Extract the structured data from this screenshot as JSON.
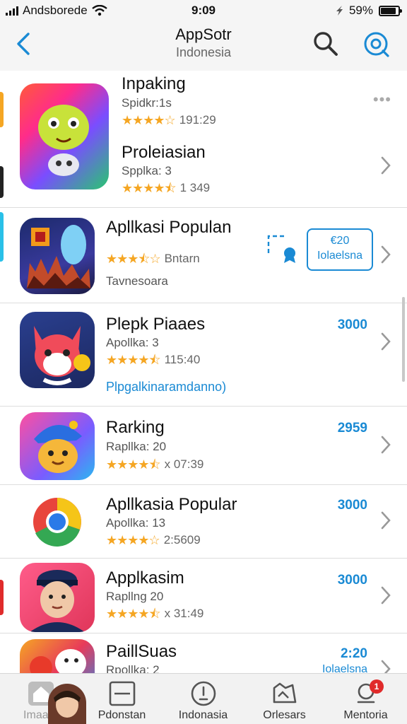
{
  "status_bar": {
    "carrier": "Andsborede",
    "time": "9:09",
    "battery": "59%"
  },
  "nav": {
    "title": "AppSotr",
    "subtitle": "Indonesia",
    "back_icon": "chevron-left-icon",
    "search_icon": "search-icon",
    "discover_icon": "compass-icon"
  },
  "featured": {
    "first": {
      "name": "Inpaking",
      "sub": "Spidkr:1s",
      "stars": 4,
      "rating_text": "191:29",
      "more": "•••"
    },
    "second": {
      "name": "Proleiasian",
      "sub": "Spplka: 3",
      "stars": 4.5,
      "rating_text": "1 349"
    }
  },
  "popular": {
    "name": "Apllkasi Populan",
    "rating_label": "Bntarn",
    "stars": 3.5,
    "category": "Tavnesoara",
    "badge_line1": "€20",
    "badge_line2": "Iolaelsna"
  },
  "list": [
    {
      "name": "Plepk Piaaes",
      "sub": "Apollka: 3",
      "stars": 4.5,
      "rating_text": "115:40",
      "price": "3000",
      "link": "Plpgalkinaramdanno)"
    },
    {
      "name": "Rarking",
      "sub": "Rapllka: 20",
      "stars": 4.5,
      "rating_text": "x 07:39",
      "price": "2959"
    },
    {
      "name": "Apllkasia Popular",
      "sub": "Apollka: 13",
      "stars": 4,
      "rating_text": "2:5609",
      "price": "3000"
    },
    {
      "name": "Applkasim",
      "sub": "Rapllng 20",
      "stars": 4.5,
      "rating_text": "x 31:49",
      "price": "3000"
    },
    {
      "name": "PaillSuas",
      "sub": "Rpollka: 2",
      "price": "2:20",
      "price_sub": "Iolaelsna"
    }
  ],
  "tabs": [
    {
      "label": "Imaam",
      "icon": "home-icon"
    },
    {
      "label": "Pdonstan",
      "icon": "apps-icon"
    },
    {
      "label": "Indonasia",
      "icon": "arrow-down-circle-icon"
    },
    {
      "label": "Orlesars",
      "icon": "games-icon"
    },
    {
      "label": "Mentoria",
      "icon": "profile-icon",
      "badge": "1"
    }
  ],
  "colors": {
    "accent": "#1a8ad4",
    "star": "#f5a623",
    "badge_red": "#e02b2b"
  }
}
